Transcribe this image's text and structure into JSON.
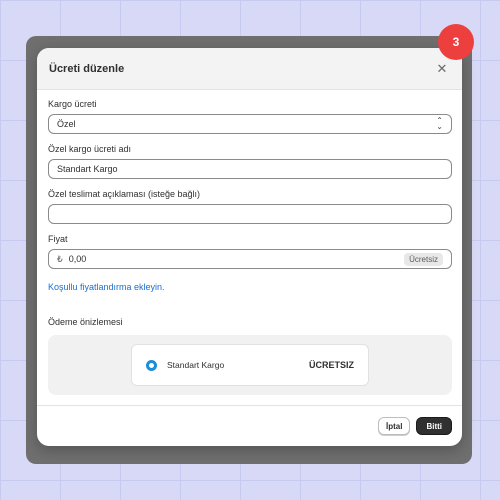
{
  "modal": {
    "title": "Ücreti düzenle",
    "close_icon": "close-icon"
  },
  "form": {
    "shipping_rate": {
      "label": "Kargo ücreti",
      "value": "Özel"
    },
    "custom_rate_name": {
      "label": "Özel kargo ücreti adı",
      "value": "Standart Kargo"
    },
    "custom_delivery_description": {
      "label": "Özel teslimat açıklaması (isteğe bağlı)",
      "value": ""
    },
    "price": {
      "label": "Fiyat",
      "currency": "₺",
      "value": "0,00",
      "badge": "Ücretsiz"
    },
    "conditional_pricing_link": "Koşullu fiyatlandırma ekleyin."
  },
  "preview": {
    "title": "Ödeme önizlemesi",
    "option_name": "Standart Kargo",
    "option_price": "ÜCRETSIZ"
  },
  "footer": {
    "cancel_label": "İptal",
    "done_label": "Bitti"
  },
  "step_badge": "3",
  "colors": {
    "background": "#d7d9f7",
    "badge": "#ee3f3f",
    "link": "#1a6fd1",
    "radio": "#1a8ed8",
    "primary_button": "#303030"
  }
}
